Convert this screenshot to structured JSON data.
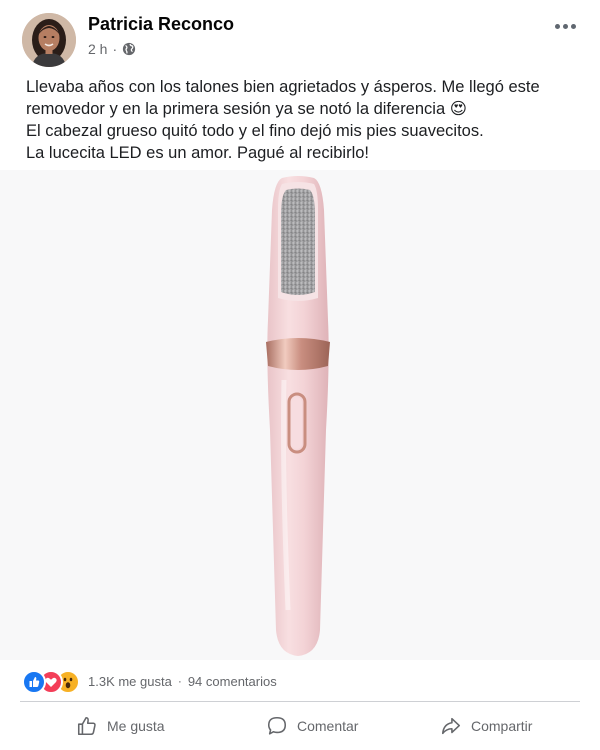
{
  "post": {
    "author": "Patricia Reconco",
    "time": "2 h",
    "separator": "·",
    "privacy_icon": "globe-icon",
    "more_icon": "more-options-icon",
    "text_lines": [
      "Llevaba años con los talones bien agrietados y ásperos. Me llegó este",
      "removedor y en la primera sesión ya se notó la diferencia 😍",
      "El cabezal grueso quitó todo y el fino dejó mis pies suavecitos.",
      "La lucecita LED es un amor. Pagué al recibirlo!"
    ]
  },
  "reactions": {
    "icons": [
      "like-reaction-icon",
      "love-reaction-icon",
      "wow-reaction-icon"
    ],
    "likes": "1.3K me gusta",
    "separator": "·",
    "comments": "94 comentarios"
  },
  "actions": {
    "like_label": "Me gusta",
    "comment_label": "Comentar",
    "share_label": "Compartir"
  },
  "colors": {
    "like_blue": "#1877f2",
    "love_red": "#f33e58",
    "wow_yellow": "#f7b125",
    "secondary_text": "#65676b",
    "product_pink": "#f3d3d6",
    "rose_gold": "#c98e80"
  }
}
